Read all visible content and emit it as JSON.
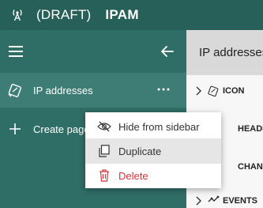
{
  "app": {
    "draft_label": "(DRAFT)",
    "name": "IPAM",
    "icon": "cellular-tower-icon"
  },
  "sidebar": {
    "menu_icon": "hamburger-icon",
    "back_icon": "arrow-left-icon",
    "items": [
      {
        "label": "IP addresses",
        "icon": "network-tag-icon",
        "more_icon": "ellipsis-icon",
        "selected": true
      }
    ],
    "create_page_label": "Create page"
  },
  "main": {
    "header_title": "IP addresses",
    "tree": [
      {
        "label": "ICON",
        "icon": "network-tag-icon",
        "expanded": false
      },
      {
        "label": "HEADER"
      },
      {
        "label": "CHANNELS"
      },
      {
        "label": "EVENTS",
        "icon": "event-icon",
        "expanded": false
      }
    ]
  },
  "context_menu": {
    "items": [
      {
        "label": "Hide from sidebar",
        "icon": "eye-off-icon"
      },
      {
        "label": "Duplicate",
        "icon": "duplicate-icon"
      },
      {
        "label": "Delete",
        "icon": "trash-icon",
        "color": "#d13438"
      }
    ]
  },
  "colors": {
    "top_bar": "#276058",
    "sidebar": "#2f6e66",
    "selected_item": "#3d7d75",
    "danger": "#d13438"
  }
}
